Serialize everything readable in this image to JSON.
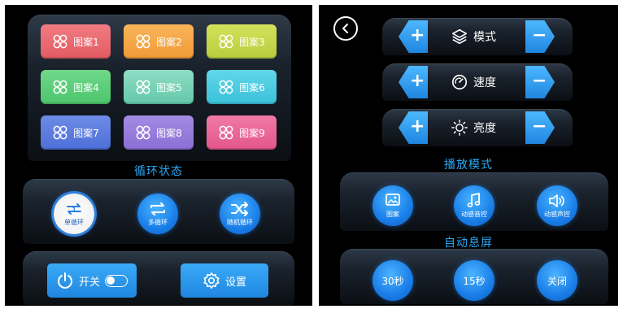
{
  "left": {
    "patterns": [
      {
        "label": "图案1",
        "color_from": "#f07c82",
        "color_to": "#e35a62"
      },
      {
        "label": "图案2",
        "color_from": "#f9b55a",
        "color_to": "#f09a37"
      },
      {
        "label": "图案3",
        "color_from": "#d4e25b",
        "color_to": "#b8cc3e"
      },
      {
        "label": "图案4",
        "color_from": "#6fd88a",
        "color_to": "#4cc56c"
      },
      {
        "label": "图案5",
        "color_from": "#8fdcc3",
        "color_to": "#63c9a9"
      },
      {
        "label": "图案6",
        "color_from": "#62d6ea",
        "color_to": "#39c1d9"
      },
      {
        "label": "图案7",
        "color_from": "#6e8be6",
        "color_to": "#4d6fd8"
      },
      {
        "label": "图案8",
        "color_from": "#a48be3",
        "color_to": "#8a6fd6"
      },
      {
        "label": "图案9",
        "color_from": "#f07aa5",
        "color_to": "#e3568b"
      }
    ],
    "loop_title": "循环状态",
    "loop_modes": [
      {
        "label": "单循环",
        "selected": true
      },
      {
        "label": "多循环",
        "selected": false
      },
      {
        "label": "随机循环",
        "selected": false
      }
    ],
    "power_label": "开关",
    "settings_label": "设置"
  },
  "right": {
    "controls": [
      {
        "label": "模式",
        "icon": "layers-icon"
      },
      {
        "label": "速度",
        "icon": "speedometer-icon"
      },
      {
        "label": "亮度",
        "icon": "sun-icon"
      }
    ],
    "plus_symbol": "+",
    "minus_symbol": "−",
    "play_title": "播放模式",
    "play_modes": [
      {
        "label": "图案",
        "icon": "image-icon"
      },
      {
        "label": "动感音控",
        "icon": "music-note-icon"
      },
      {
        "label": "动感声控",
        "icon": "speaker-icon"
      }
    ],
    "sleep_title": "自动息屏",
    "sleep_options": [
      "30秒",
      "15秒",
      "关闭"
    ]
  },
  "colors": {
    "accent": "#2aa8f5",
    "button_blue": "#1f86e0",
    "background": "#000000"
  }
}
